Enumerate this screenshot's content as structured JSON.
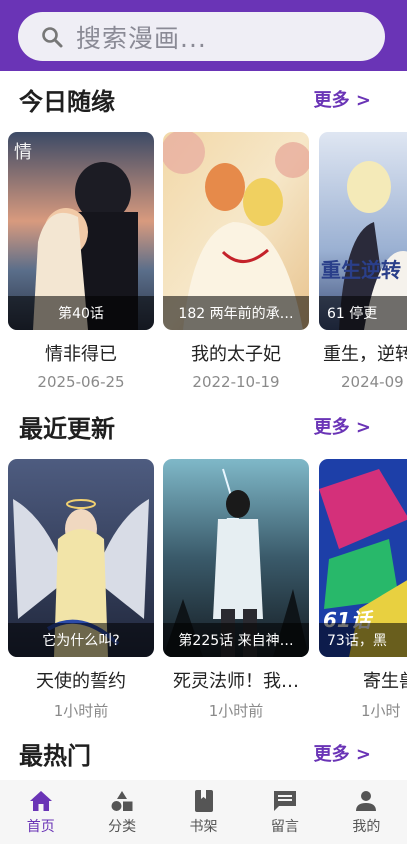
{
  "search": {
    "placeholder": "搜索漫画..."
  },
  "sections": [
    {
      "title": "今日随缘",
      "more": "更多 >",
      "items": [
        {
          "badge": "第40话",
          "title": "情非得已",
          "sub": "2025-06-25"
        },
        {
          "badge": "182 两年前的承…",
          "title": "我的太子妃",
          "sub": "2022-10-19"
        },
        {
          "badge": "61 停更",
          "title": "重生，逆转",
          "sub": "2024-09"
        }
      ]
    },
    {
      "title": "最近更新",
      "more": "更多 >",
      "items": [
        {
          "badge": "它为什么叫?",
          "title": "天使的誓约",
          "sub": "1小时前"
        },
        {
          "badge": "第225话 来自神…",
          "title": "死灵法师！我…",
          "sub": "1小时前"
        },
        {
          "badge": "73话，黑",
          "title": "寄生兽",
          "sub": "1小时"
        }
      ]
    },
    {
      "title": "最热门",
      "more": "更多 >"
    }
  ],
  "tabs": [
    {
      "label": "首页",
      "icon": "home-icon",
      "active": true
    },
    {
      "label": "分类",
      "icon": "category-icon",
      "active": false
    },
    {
      "label": "书架",
      "icon": "bookshelf-icon",
      "active": false
    },
    {
      "label": "留言",
      "icon": "message-icon",
      "active": false
    },
    {
      "label": "我的",
      "icon": "profile-icon",
      "active": false
    }
  ],
  "colors": {
    "brand": "#6a34b6",
    "tab_active": "#6a34b6",
    "tab_inactive": "#555555"
  }
}
